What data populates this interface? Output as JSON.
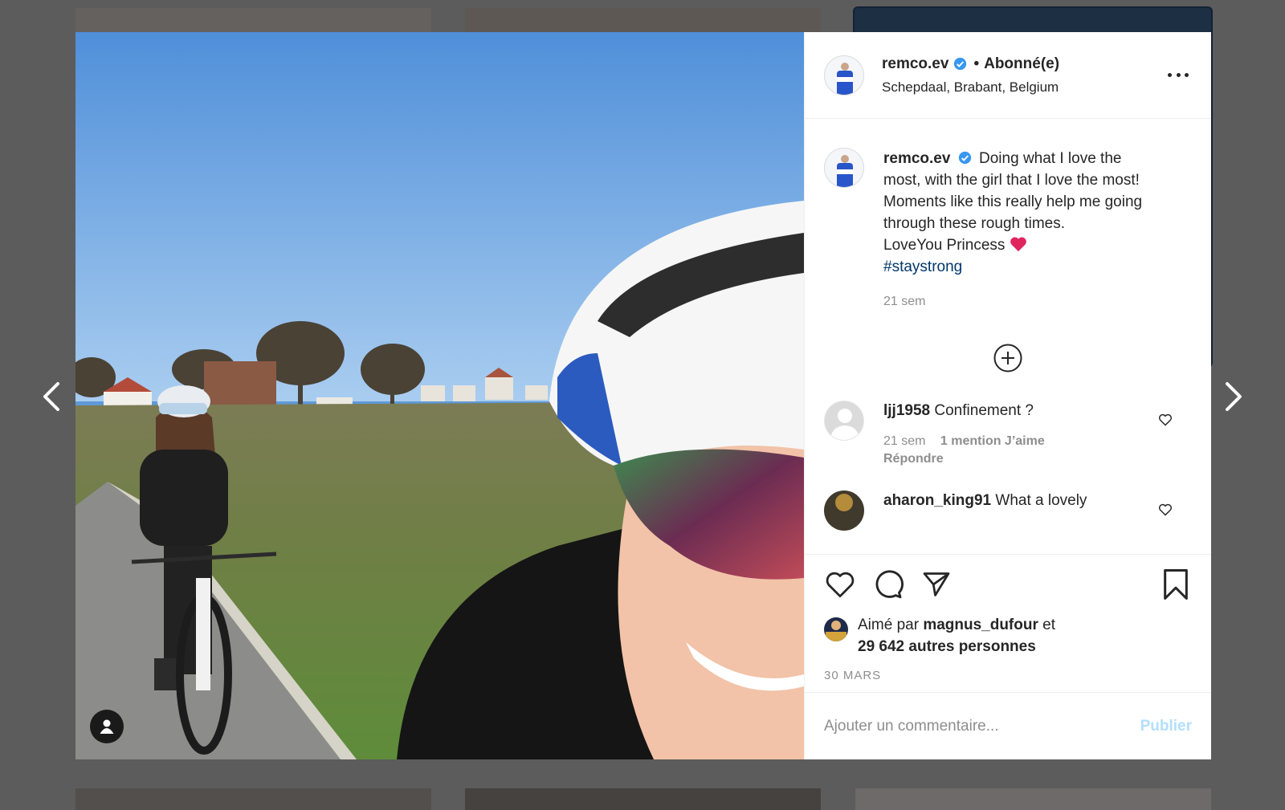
{
  "post": {
    "username": "remco.ev",
    "dot": "•",
    "follow_status": "Abonné(e)",
    "location": "Schepdaal, Brabant, Belgium"
  },
  "caption": {
    "username": "remco.ev",
    "line1": "Doing what I love the most, with the girl that I love the most!",
    "line2": "Moments like this really help me going through these rough times.",
    "line3": "LoveYou Princess",
    "hashtag": "#staystrong",
    "time": "21 sem"
  },
  "comments": [
    {
      "username": "ljj1958",
      "text": "Confinement ?",
      "time": "21 sem",
      "likes": "1 mention J’aime",
      "reply": "Répondre"
    },
    {
      "username": "aharon_king91",
      "text": "What a lovely"
    }
  ],
  "likes": {
    "prefix": "Aimé par",
    "user": "magnus_dufour",
    "conj": "et",
    "others": "29 642 autres personnes"
  },
  "date": "30 MARS",
  "comment_input": {
    "placeholder": "Ajouter un commentaire..."
  },
  "publish_label": "Publier",
  "icons": {
    "like": "heart-icon",
    "comment": "comment-bubble-icon",
    "share": "paper-plane-icon",
    "save": "bookmark-icon",
    "more": "more-dots-icon",
    "verified": "verified-badge-icon",
    "load_more": "plus-circle-icon",
    "user_tag": "user-tag-icon",
    "prev": "chevron-left-icon",
    "next": "chevron-right-icon"
  },
  "colors": {
    "verified_blue": "#3897f0",
    "hashtag": "#00376b",
    "publish_disabled": "#b2dffc",
    "emoji_heart": "#e0245e"
  }
}
